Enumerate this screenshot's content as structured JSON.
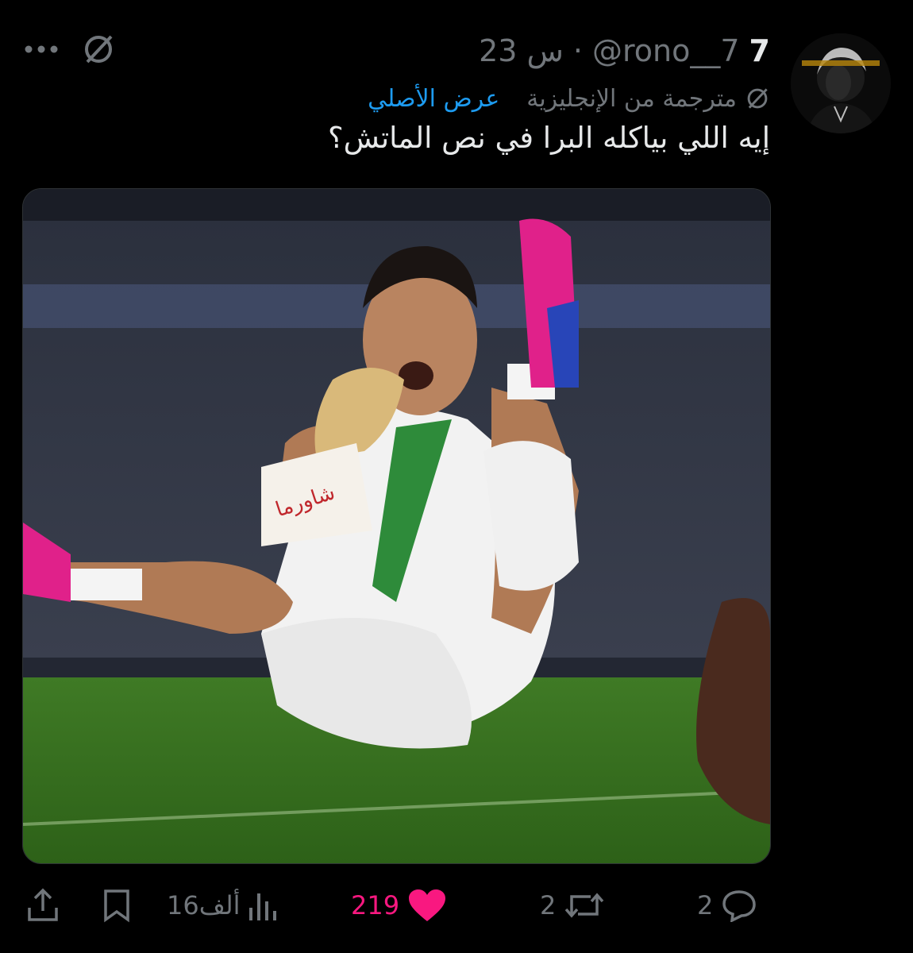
{
  "tweet": {
    "display_name": "7",
    "handle": "@rono__7",
    "separator": "·",
    "time": "23 س",
    "translated_label": "مترجمة من الإنجليزية",
    "show_original": "عرض الأصلي",
    "text": "إيه اللي بياكله البرا في نص الماتش؟"
  },
  "media": {
    "wrap_text": "شاورما"
  },
  "actions": {
    "replies": "2",
    "reposts": "2",
    "likes": "219",
    "views": "16ألف"
  },
  "colors": {
    "background": "#000000",
    "text": "#e7e9ea",
    "muted": "#71767b",
    "link": "#1d9bf0",
    "like": "#f91880"
  },
  "icons": [
    "more-icon",
    "grok-icon",
    "translate-icon",
    "reply-icon",
    "repost-icon",
    "like-icon",
    "views-icon",
    "bookmark-icon",
    "share-icon"
  ]
}
